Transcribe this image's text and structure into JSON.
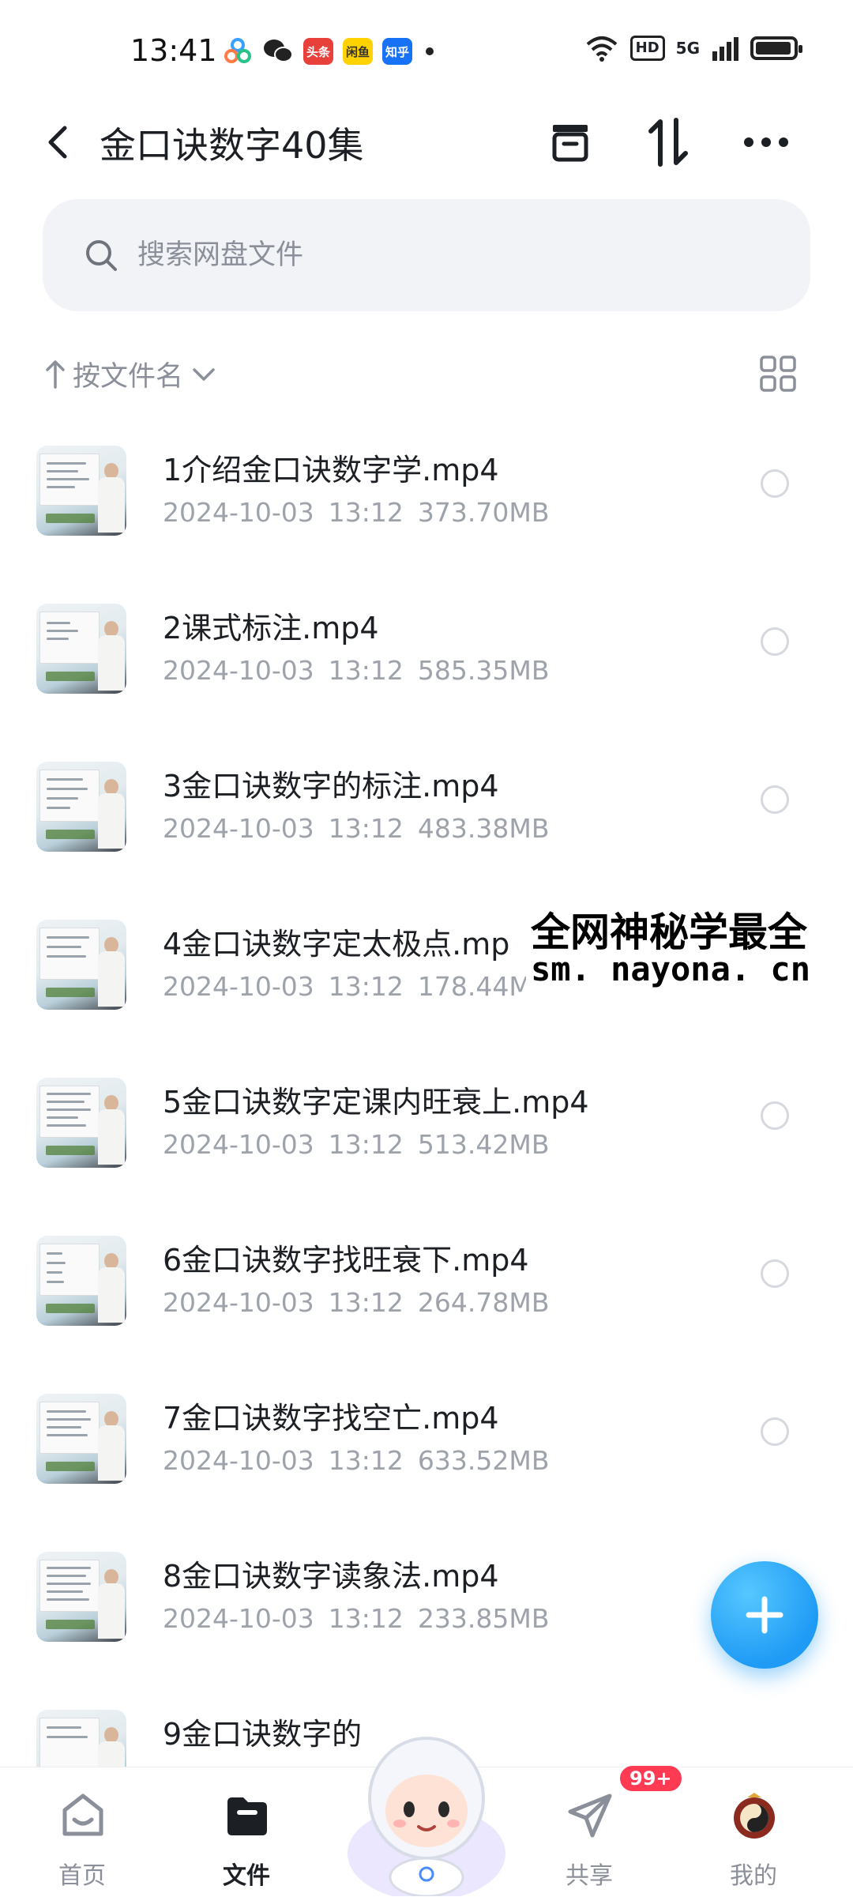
{
  "status_bar": {
    "time": "13:41",
    "apps": [
      {
        "label": "",
        "icon": "baidu-netdisk-icon",
        "color": "#4a8cff"
      },
      {
        "label": "",
        "icon": "wechat-icon",
        "color": "#222222"
      },
      {
        "label": "头条",
        "icon": "toutiao-icon",
        "color": "#e8413b"
      },
      {
        "label": "闲鱼",
        "icon": "xianyu-icon",
        "color": "#ffd200"
      },
      {
        "label": "知乎",
        "icon": "zhihu-icon",
        "color": "#1772f6"
      }
    ],
    "hd": "HD",
    "network": "5G"
  },
  "header": {
    "title": "金口诀数字40集"
  },
  "search": {
    "placeholder": "搜索网盘文件"
  },
  "sort": {
    "label": "按文件名"
  },
  "files": [
    {
      "name": "1介绍金口诀数字学.mp4",
      "date": "2024-10-03",
      "time": "13:12",
      "size": "373.70MB"
    },
    {
      "name": "2课式标注.mp4",
      "date": "2024-10-03",
      "time": "13:12",
      "size": "585.35MB"
    },
    {
      "name": "3金口诀数字的标注.mp4",
      "date": "2024-10-03",
      "time": "13:12",
      "size": "483.38MB"
    },
    {
      "name": "4金口诀数字定太极点.mp",
      "date": "2024-10-03",
      "time": "13:12",
      "size": "178.44MB"
    },
    {
      "name": "5金口诀数字定课内旺衰上.mp4",
      "date": "2024-10-03",
      "time": "13:12",
      "size": "513.42MB"
    },
    {
      "name": "6金口诀数字找旺衰下.mp4",
      "date": "2024-10-03",
      "time": "13:12",
      "size": "264.78MB"
    },
    {
      "name": "7金口诀数字找空亡.mp4",
      "date": "2024-10-03",
      "time": "13:12",
      "size": "633.52MB"
    },
    {
      "name": "8金口诀数字读象法.mp4",
      "date": "2024-10-03",
      "time": "13:12",
      "size": "233.85MB"
    },
    {
      "name": "9金口诀数字的",
      "date": "",
      "time": "",
      "size": ""
    }
  ],
  "watermark": {
    "line1": "全网神秘学最全",
    "line2": "sm. nayona. cn"
  },
  "bottom_nav": {
    "items": [
      {
        "label": "首页",
        "icon": "home-face-icon"
      },
      {
        "label": "文件",
        "icon": "folder-icon"
      },
      {
        "label": "共享",
        "icon": "paper-plane-icon"
      },
      {
        "label": "我的",
        "icon": "avatar-yinyang-icon"
      }
    ],
    "share_badge": "99+"
  },
  "colors": {
    "accent": "#1f9bf5",
    "badge": "#ff3b54",
    "meta_text": "#9ea3ab"
  }
}
